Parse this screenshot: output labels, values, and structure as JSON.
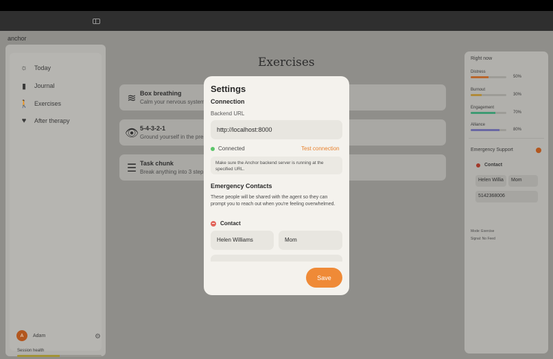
{
  "app": {
    "brand": "anchor"
  },
  "sidebar": {
    "items": [
      {
        "label": "Today",
        "icon": "sun-icon"
      },
      {
        "label": "Journal",
        "icon": "book-icon"
      },
      {
        "label": "Exercises",
        "icon": "walking-person-icon"
      },
      {
        "label": "After therapy",
        "icon": "heart-icon"
      }
    ],
    "user": {
      "initial": "A",
      "name": "Adam"
    },
    "session_health": {
      "label": "Session health",
      "value": 0.5
    }
  },
  "main": {
    "title": "Exercises",
    "exercises": [
      {
        "name": "Box breathing",
        "desc": "Calm your nervous system",
        "icon": "wind-icon"
      },
      {
        "name": "5-4-3-2-1",
        "desc": "Ground yourself in the present",
        "icon": "eye-icon"
      },
      {
        "name": "Task chunk",
        "desc": "Break anything into 3 steps",
        "icon": "list-icon"
      }
    ]
  },
  "right_panel": {
    "title": "Right now",
    "metrics": [
      {
        "label": "Distress",
        "value": "50%",
        "fraction": 0.5,
        "color": "#b8662d"
      },
      {
        "label": "Burnout",
        "value": "30%",
        "fraction": 0.3,
        "color": "#b08a39"
      },
      {
        "label": "Engagement",
        "value": "70%",
        "fraction": 0.7,
        "color": "#3e9a72"
      },
      {
        "label": "Alliance",
        "value": "80%",
        "fraction": 0.8,
        "color": "#6a68a3"
      }
    ],
    "emergency_label": "Emergency Support",
    "contact_label": "Contact",
    "contact_name": "Helen Willia",
    "contact_relation": "Mom",
    "contact_phone": "5142368006",
    "mode": "Mode: Exercise",
    "signal": "Signal: No Feed"
  },
  "modal": {
    "title": "Settings",
    "connection_title": "Connection",
    "backend_label": "Backend URL",
    "backend_url": "http://localhost:8000",
    "status": "Connected",
    "status_color": "#5cc56a",
    "test_label": "Test connection",
    "help": "Make sure the Anchor backend server is running at the specified URL.",
    "emergency_title": "Emergency Contacts",
    "emergency_desc": "These people will be shared with the agent so they can prompt you to reach out when you're feeling overwhelmed.",
    "contact_label": "Contact",
    "contact_name": "Helen Williams",
    "contact_relation": "Mom",
    "save_label": "Save",
    "accent": "#ef8a37"
  }
}
